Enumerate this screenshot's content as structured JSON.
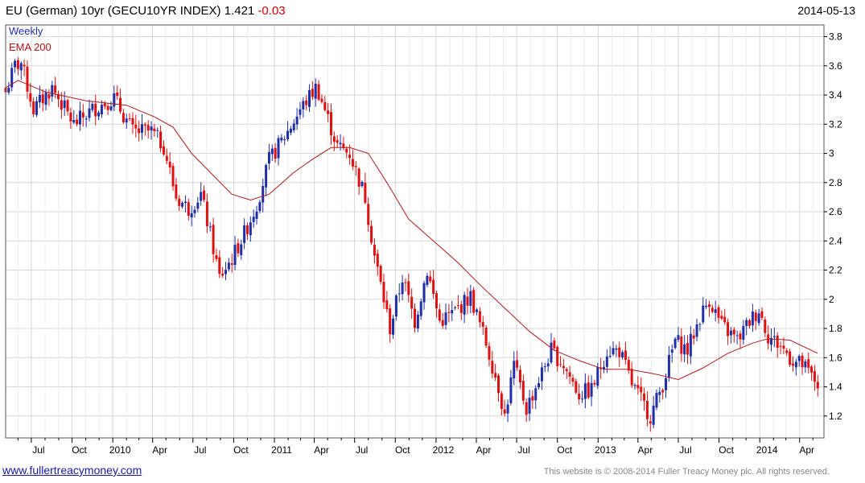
{
  "header": {
    "title": "EU (German) 10yr (GECU10YR INDEX) 1.421",
    "change": "-0.03",
    "date": "2014-05-13"
  },
  "legend": {
    "series1": "Weekly",
    "series2": "EMA 200"
  },
  "footer": {
    "site": "www.fullertreacymoney.com",
    "copyright": "This website is © 2008-2014 Fuller Treacy Money plc. All rights reserved."
  },
  "colors": {
    "up": "#1f2fa8",
    "down": "#e01010",
    "ema": "#b01a1a",
    "grid": "#d6d6d6",
    "frame": "#555555"
  },
  "chart_data": {
    "type": "line",
    "y_axis_side": "right",
    "ylim": [
      1.05,
      3.88
    ],
    "yticks": [
      1.2,
      1.4,
      1.6,
      1.8,
      2,
      2.2,
      2.4,
      2.6,
      2.8,
      3,
      3.2,
      3.4,
      3.6,
      3.8
    ],
    "x_tick_labels": [
      "Jul",
      "Oct",
      "2010",
      "Apr",
      "Jul",
      "Oct",
      "2011",
      "Apr",
      "Jul",
      "Oct",
      "2012",
      "Apr",
      "Jul",
      "Oct",
      "2013",
      "Apr",
      "Jul",
      "Oct",
      "2014",
      "Apr"
    ],
    "xlim": [
      "2009-05-04",
      "2014-05-26"
    ],
    "grid": true,
    "weekly_close_anchors": [
      {
        "date": "2009-05-04",
        "value": 3.42
      },
      {
        "date": "2009-05-25",
        "value": 3.6
      },
      {
        "date": "2009-06-08",
        "value": 3.62
      },
      {
        "date": "2009-07-06",
        "value": 3.3
      },
      {
        "date": "2009-08-17",
        "value": 3.45
      },
      {
        "date": "2009-10-05",
        "value": 3.2
      },
      {
        "date": "2009-11-16",
        "value": 3.3
      },
      {
        "date": "2010-01-04",
        "value": 3.38
      },
      {
        "date": "2010-02-15",
        "value": 3.15
      },
      {
        "date": "2010-03-29",
        "value": 3.15
      },
      {
        "date": "2010-04-26",
        "value": 3.05
      },
      {
        "date": "2010-05-24",
        "value": 2.7
      },
      {
        "date": "2010-06-21",
        "value": 2.62
      },
      {
        "date": "2010-07-19",
        "value": 2.72
      },
      {
        "date": "2010-08-16",
        "value": 2.35
      },
      {
        "date": "2010-08-30",
        "value": 2.15
      },
      {
        "date": "2010-09-27",
        "value": 2.28
      },
      {
        "date": "2010-10-25",
        "value": 2.45
      },
      {
        "date": "2010-11-22",
        "value": 2.65
      },
      {
        "date": "2010-12-20",
        "value": 2.95
      },
      {
        "date": "2011-01-31",
        "value": 3.15
      },
      {
        "date": "2011-02-28",
        "value": 3.3
      },
      {
        "date": "2011-04-04",
        "value": 3.45
      },
      {
        "date": "2011-04-11",
        "value": 3.42
      },
      {
        "date": "2011-05-23",
        "value": 3.05
      },
      {
        "date": "2011-06-20",
        "value": 3.0
      },
      {
        "date": "2011-07-25",
        "value": 2.7
      },
      {
        "date": "2011-08-15",
        "value": 2.3
      },
      {
        "date": "2011-09-19",
        "value": 1.8
      },
      {
        "date": "2011-10-17",
        "value": 2.15
      },
      {
        "date": "2011-11-14",
        "value": 1.85
      },
      {
        "date": "2011-12-12",
        "value": 2.2
      },
      {
        "date": "2012-01-09",
        "value": 1.85
      },
      {
        "date": "2012-02-06",
        "value": 1.9
      },
      {
        "date": "2012-03-19",
        "value": 2.02
      },
      {
        "date": "2012-04-23",
        "value": 1.7
      },
      {
        "date": "2012-05-21",
        "value": 1.4
      },
      {
        "date": "2012-06-04",
        "value": 1.2
      },
      {
        "date": "2012-06-25",
        "value": 1.55
      },
      {
        "date": "2012-07-23",
        "value": 1.25
      },
      {
        "date": "2012-08-20",
        "value": 1.45
      },
      {
        "date": "2012-09-17",
        "value": 1.65
      },
      {
        "date": "2012-10-15",
        "value": 1.55
      },
      {
        "date": "2012-11-19",
        "value": 1.35
      },
      {
        "date": "2012-12-17",
        "value": 1.38
      },
      {
        "date": "2013-01-21",
        "value": 1.65
      },
      {
        "date": "2013-02-18",
        "value": 1.65
      },
      {
        "date": "2013-03-18",
        "value": 1.42
      },
      {
        "date": "2013-04-29",
        "value": 1.2
      },
      {
        "date": "2013-05-27",
        "value": 1.42
      },
      {
        "date": "2013-06-24",
        "value": 1.72
      },
      {
        "date": "2013-07-22",
        "value": 1.65
      },
      {
        "date": "2013-08-19",
        "value": 1.88
      },
      {
        "date": "2013-09-09",
        "value": 2.0
      },
      {
        "date": "2013-10-07",
        "value": 1.82
      },
      {
        "date": "2013-11-11",
        "value": 1.72
      },
      {
        "date": "2013-12-09",
        "value": 1.85
      },
      {
        "date": "2013-12-30",
        "value": 1.93
      },
      {
        "date": "2014-01-20",
        "value": 1.75
      },
      {
        "date": "2014-02-17",
        "value": 1.68
      },
      {
        "date": "2014-03-17",
        "value": 1.58
      },
      {
        "date": "2014-04-07",
        "value": 1.55
      },
      {
        "date": "2014-05-12",
        "value": 1.42
      }
    ],
    "ema200_anchors": [
      {
        "date": "2009-05-04",
        "value": 3.45
      },
      {
        "date": "2009-06-01",
        "value": 3.5
      },
      {
        "date": "2009-08-03",
        "value": 3.42
      },
      {
        "date": "2009-11-02",
        "value": 3.36
      },
      {
        "date": "2010-02-01",
        "value": 3.33
      },
      {
        "date": "2010-04-05",
        "value": 3.25
      },
      {
        "date": "2010-05-17",
        "value": 3.18
      },
      {
        "date": "2010-06-28",
        "value": 3.0
      },
      {
        "date": "2010-08-09",
        "value": 2.87
      },
      {
        "date": "2010-09-27",
        "value": 2.72
      },
      {
        "date": "2010-11-08",
        "value": 2.68
      },
      {
        "date": "2010-12-20",
        "value": 2.72
      },
      {
        "date": "2011-02-14",
        "value": 2.87
      },
      {
        "date": "2011-03-28",
        "value": 2.96
      },
      {
        "date": "2011-05-09",
        "value": 3.04
      },
      {
        "date": "2011-06-20",
        "value": 3.04
      },
      {
        "date": "2011-08-01",
        "value": 3.0
      },
      {
        "date": "2011-09-12",
        "value": 2.8
      },
      {
        "date": "2011-10-31",
        "value": 2.55
      },
      {
        "date": "2011-12-26",
        "value": 2.4
      },
      {
        "date": "2012-02-20",
        "value": 2.25
      },
      {
        "date": "2012-04-09",
        "value": 2.1
      },
      {
        "date": "2012-06-04",
        "value": 1.94
      },
      {
        "date": "2012-07-30",
        "value": 1.78
      },
      {
        "date": "2012-09-24",
        "value": 1.65
      },
      {
        "date": "2012-11-19",
        "value": 1.58
      },
      {
        "date": "2013-01-14",
        "value": 1.52
      },
      {
        "date": "2013-03-11",
        "value": 1.52
      },
      {
        "date": "2013-05-06",
        "value": 1.49
      },
      {
        "date": "2013-07-01",
        "value": 1.45
      },
      {
        "date": "2013-08-26",
        "value": 1.53
      },
      {
        "date": "2013-10-21",
        "value": 1.63
      },
      {
        "date": "2013-12-16",
        "value": 1.7
      },
      {
        "date": "2014-01-20",
        "value": 1.73
      },
      {
        "date": "2014-03-10",
        "value": 1.72
      },
      {
        "date": "2014-05-12",
        "value": 1.63
      }
    ]
  }
}
